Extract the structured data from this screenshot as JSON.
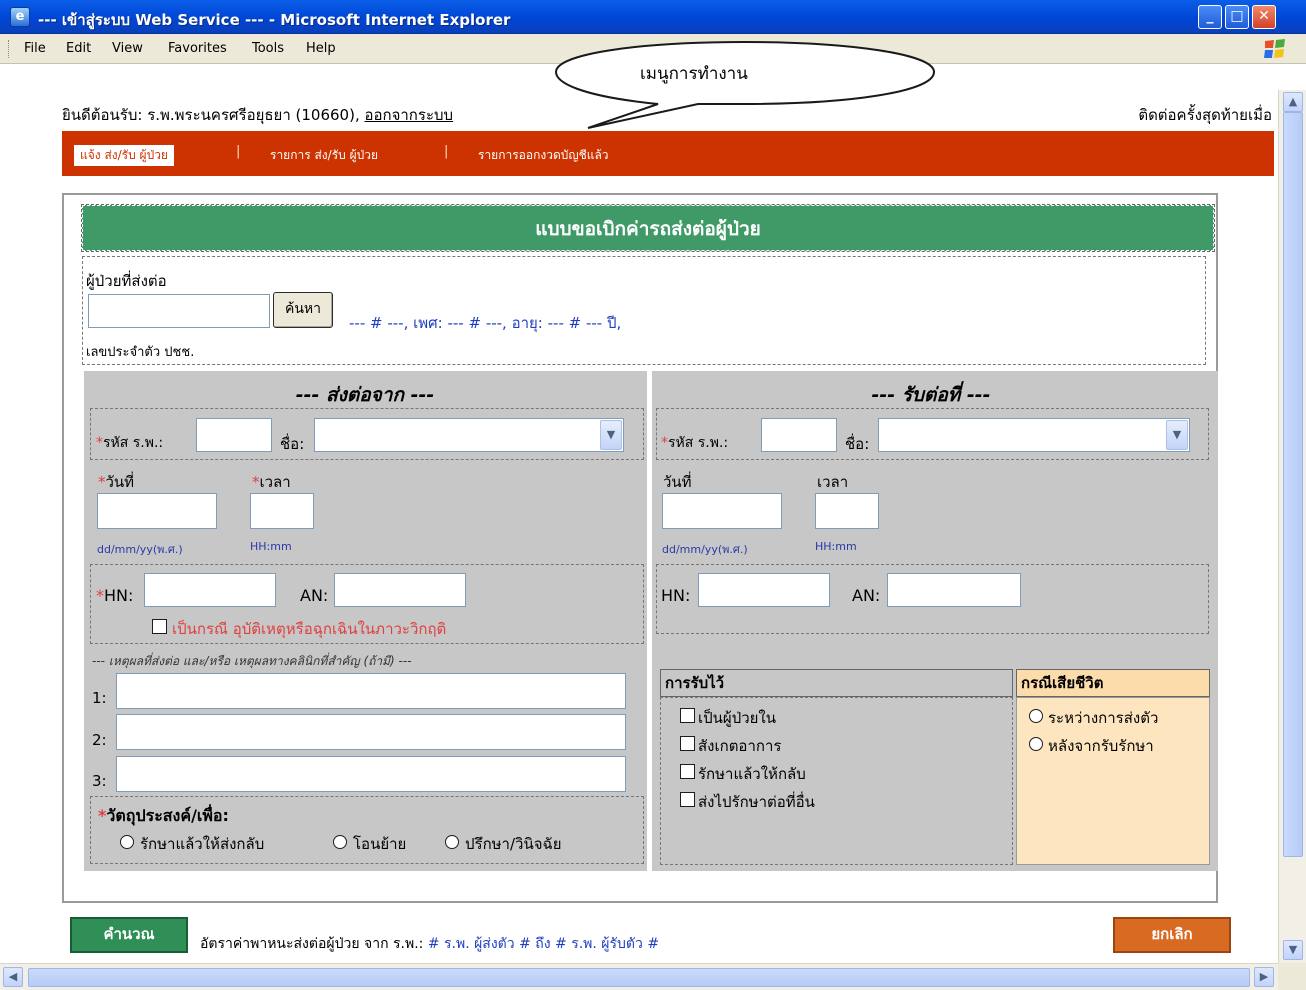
{
  "window": {
    "title": "--- เข้าสู่ระบบ Web Service --- - Microsoft Internet Explorer",
    "minimize": "_",
    "maximize": "□",
    "close": "✕"
  },
  "menu": {
    "items": [
      "File",
      "Edit",
      "View",
      "Favorites",
      "Tools",
      "Help"
    ]
  },
  "header": {
    "welcome": "ยินดีต้อนรับ: ร.พ.พระนครศรีอยุธยา (10660),",
    "logout": "ออกจากระบบ",
    "last_login": "ติดต่อครั้งสุดท้ายเมื่อ"
  },
  "nav": {
    "items": [
      "แจ้ง ส่ง/รับ ผู้ป่วย",
      "รายการ ส่ง/รับ ผู้ป่วย",
      "รายการออกงวดบัญชีแล้ว"
    ],
    "separator": "|"
  },
  "callout": {
    "text": "เมนูการทำงาน"
  },
  "form": {
    "title": "แบบขอเบิกค่ารถส่งต่อผู้ป่วย",
    "patient": {
      "label": "ผู้ป่วยที่ส่งต่อ",
      "search_button": "ค้นหา",
      "info_prefix": "--- # ---, เพศ: --- # ---, อายุ: --- # --- ปี,",
      "id_label": "เลขประจำตัว ปชช.",
      "id_value": ""
    },
    "from": {
      "title": "--- ส่งต่อจาก ---",
      "star": "*",
      "hospital_code_label": "รหัส ร.พ.:",
      "name_label": "ชื่อ:",
      "date_label": "วันที่",
      "time_label": "เวลา",
      "date_hint": "dd/mm/yy(พ.ศ.)",
      "time_hint": "HH:mm",
      "hn_label": "HN:",
      "an_label": "AN:",
      "emergency_label": "เป็นกรณี อุบัติเหตุหรือฉุกเฉินในภาวะวิกฤติ",
      "reason_label": "--- เหตุผลที่ส่งต่อ และ/หรือ เหตุผลทางคลินิกที่สำคัญ (ถ้ามี) ---",
      "reason_numbers": [
        "1:",
        "2:",
        "3:"
      ],
      "purpose_label": "วัตถุประสงค์/เพื่อ:",
      "purpose_options": [
        "รักษาแล้วให้ส่งกลับ",
        "โอนย้าย",
        "ปรึกษา/วินิจฉัย"
      ]
    },
    "to": {
      "title": "--- รับต่อที่ ---",
      "hospital_code_label": "รหัส ร.พ.:",
      "name_label": "ชื่อ:",
      "date_label": "วันที่",
      "time_label": "เวลา",
      "date_hint": "dd/mm/yy(พ.ศ.)",
      "time_hint": "HH:mm",
      "hn_label": "HN:",
      "an_label": "AN:"
    },
    "admission": {
      "header": "การรับไว้",
      "options": [
        "เป็นผู้ป่วยใน",
        "สังเกตอาการ",
        "รักษาแล้วให้กลับ",
        "ส่งไปรักษาต่อที่อื่น"
      ]
    },
    "death": {
      "header": "กรณีเสียชีวิต",
      "options": [
        "ระหว่างการส่งตัว",
        "หลังจากรับรักษา"
      ]
    }
  },
  "footer": {
    "calc_button": "คำนวณ",
    "rate_label": "อัตราค่าพาหนะส่งต่อผู้ป่วย จาก ร.พ.:",
    "rate_value": "# ร.พ. ผู้ส่งตัว # ถึง # ร.พ. ผู้รับตัว #",
    "cancel_button": "ยกเลิก"
  },
  "colors": {
    "nav_bar": "#cc3300",
    "form_title_bg": "#3f9a68",
    "required": "#e04040",
    "calc_button": "#2f8f57",
    "cancel_button": "#d96a22"
  }
}
